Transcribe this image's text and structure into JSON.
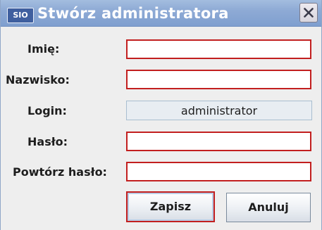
{
  "window": {
    "app_icon_text": "SIO",
    "title": "Stwórz administratora",
    "close_icon": "close-icon"
  },
  "form": {
    "first_name": {
      "label": "Imię:",
      "value": ""
    },
    "last_name": {
      "label": "Nazwisko:",
      "value": ""
    },
    "login": {
      "label": "Login:",
      "value": "administrator"
    },
    "password": {
      "label": "Hasło:",
      "value": ""
    },
    "repeat_password": {
      "label": "Powtórz hasło:",
      "value": ""
    }
  },
  "buttons": {
    "save_label": "Zapisz",
    "cancel_label": "Anuluj"
  },
  "colors": {
    "invalid_border": "#c21f1f",
    "titlebar": "#8eaad5"
  }
}
